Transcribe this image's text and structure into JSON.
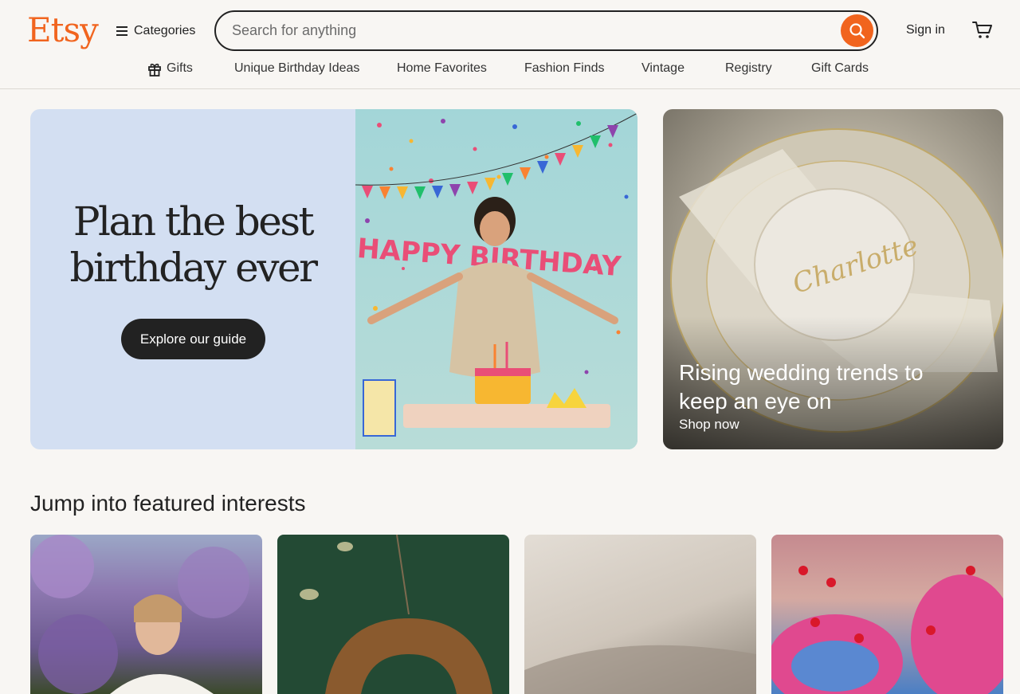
{
  "header": {
    "logo": "Etsy",
    "categories_label": "Categories",
    "search_placeholder": "Search for anything",
    "signin_label": "Sign in"
  },
  "nav": {
    "items": [
      "Gifts",
      "Unique Birthday Ideas",
      "Home Favorites",
      "Fashion Finds",
      "Vintage",
      "Registry",
      "Gift Cards"
    ]
  },
  "hero": {
    "title_line1": "Plan the best",
    "title_line2": "birthday ever",
    "button_label": "Explore our guide",
    "banner_text": "HAPPY BIRTHDAY"
  },
  "promo": {
    "title": "Rising wedding trends to keep an eye on",
    "link": "Shop now",
    "name_on_card": "Charlotte"
  },
  "featured": {
    "title": "Jump into featured interests"
  },
  "colors": {
    "brand": "#f1641e",
    "hero_bg": "#d3dff2",
    "button_dark": "#222222"
  },
  "icons": [
    "hamburger-icon",
    "search-icon",
    "cart-icon",
    "gift-icon"
  ]
}
